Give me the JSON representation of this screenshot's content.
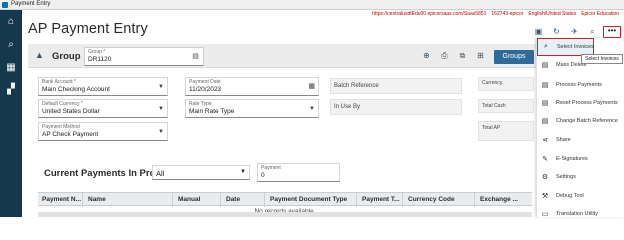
{
  "window": {
    "title": "Payment Entry"
  },
  "info_bar": {
    "url": "https://centralusdtEdu00.epicorsaas.com/Saas5851",
    "company": "162743-epicor",
    "language": "English/United States",
    "site": "Epicor Education"
  },
  "page": {
    "title": "AP Payment Entry"
  },
  "sidebar": {
    "items": [
      {
        "icon": "home-icon",
        "glyph": "⌂"
      },
      {
        "icon": "search-icon",
        "glyph": "⌕"
      },
      {
        "icon": "apps-grid-icon",
        "glyph": "▦"
      },
      {
        "icon": "dashboard-icon",
        "glyph": "▞"
      }
    ]
  },
  "toolbar": {
    "save_glyph": "▣",
    "refresh_glyph": "↻",
    "actions_glyph": "✈",
    "search_glyph": "⌕",
    "more_glyph": "•••"
  },
  "group_panel": {
    "label": "Group",
    "group_field": {
      "label": "Group *",
      "value": "DR1120"
    },
    "groups_button": "Groups"
  },
  "form": {
    "bank_account": {
      "label": "Bank Account *",
      "value": "Main Checking Account"
    },
    "payment_date": {
      "label": "Payment Date",
      "value": "11/20/2023"
    },
    "batch_reference": {
      "label": "Batch Reference"
    },
    "currency": {
      "label": "Currency"
    },
    "default_currency": {
      "label": "Default Currency *",
      "value": "United States Dollar"
    },
    "rate_type": {
      "label": "Rate Type",
      "value": "Main Rate Type"
    },
    "in_use_by": {
      "label": "In Use By"
    },
    "total_cash": {
      "label": "Total Cash"
    },
    "payment_method": {
      "label": "Payment Method",
      "value": "AP Check Payment"
    },
    "total_ap": {
      "label": "Total AP"
    }
  },
  "payments_section": {
    "title": "Current Payments In Process",
    "filter_value": "All",
    "payment_field": {
      "label": "Payment",
      "value": "0"
    }
  },
  "table": {
    "columns": [
      "Payment N...",
      "Name",
      "Manual",
      "Date",
      "Payment Document Type",
      "Payment T...",
      "Currency Code",
      "Exchange ..."
    ],
    "empty_text": "No records available."
  },
  "overflow_menu": {
    "items": [
      {
        "icon": "search-icon",
        "glyph": "⌕",
        "label": "Select Invoices"
      },
      {
        "icon": "mass-delete-icon",
        "glyph": "▤",
        "label": "Mass Delete"
      },
      {
        "icon": "process-icon",
        "glyph": "▤",
        "label": "Process Payments"
      },
      {
        "icon": "reset-icon",
        "glyph": "▤",
        "label": "Reset Process Payments"
      },
      {
        "icon": "batch-icon",
        "glyph": "▤",
        "label": "Change Batch Reference"
      },
      {
        "icon": "share-icon",
        "glyph": "⋖",
        "label": "Share"
      },
      {
        "icon": "signature-icon",
        "glyph": "✎",
        "label": "E-Signatures"
      },
      {
        "icon": "gear-icon",
        "glyph": "⚙",
        "label": "Settings"
      },
      {
        "icon": "debug-icon",
        "glyph": "⚒",
        "label": "Debug Tool"
      },
      {
        "icon": "translate-icon",
        "glyph": "▭",
        "label": "Translation Utility"
      }
    ],
    "tooltip": "Select Invoices"
  },
  "colors": {
    "sidebar": "#16384d",
    "primary_button": "#2f6b9a",
    "highlight_border": "#d62020",
    "info_text": "#c00000"
  }
}
